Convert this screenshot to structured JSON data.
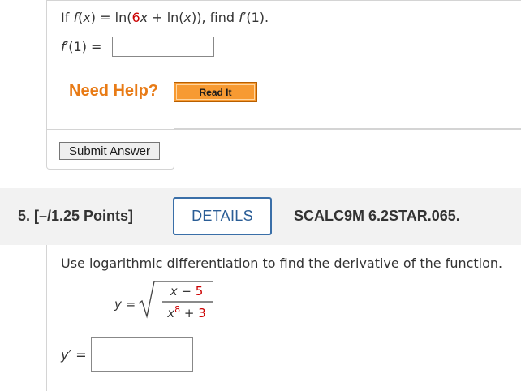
{
  "question4": {
    "prompt_if": "If ",
    "prompt_f": "f",
    "prompt_open": "(",
    "prompt_x": "x",
    "prompt_eq": ") = ln(",
    "prompt_coef": "6",
    "prompt_x2": "x",
    "prompt_rest": " + ln(",
    "prompt_x3": "x",
    "prompt_close": ")), find ",
    "prompt_fprime": "f′",
    "prompt_end": "(1).",
    "answer_label_f": "f′",
    "answer_label_rest": "(1) = ",
    "answer_value": "",
    "need_help": "Need Help?",
    "read_it": "Read It",
    "submit": "Submit Answer"
  },
  "question5": {
    "title": "5.  [–/1.25 Points]",
    "details": "DETAILS",
    "code": "SCALC9M 6.2STAR.065.",
    "prompt": "Use logarithmic differentiation to find the derivative of the function.",
    "eq_lhs": "y =",
    "num_x": "x",
    "num_minus": " − ",
    "num_const": "5",
    "den_x": "x",
    "den_exp": "8",
    "den_plus": " + ",
    "den_const": "3",
    "answer_label_y": "y′",
    "answer_label_eq": " =",
    "answer_value": ""
  }
}
